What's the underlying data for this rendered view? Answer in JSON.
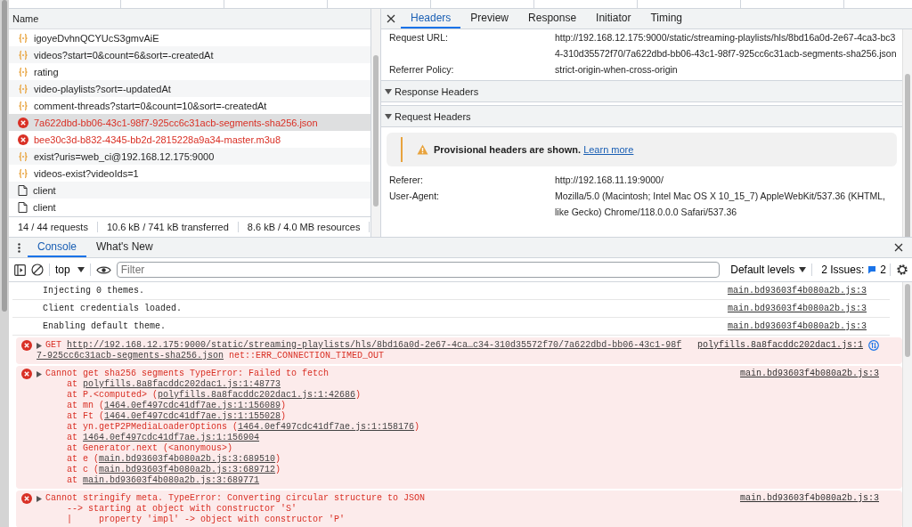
{
  "network": {
    "column_name": "Name",
    "requests": [
      {
        "name": "igoyeDvhnQCYUcS3gmvAiE",
        "kind": "fetch",
        "selected": false
      },
      {
        "name": "videos?start=0&count=6&sort=-createdAt",
        "kind": "fetch",
        "selected": false
      },
      {
        "name": "rating",
        "kind": "fetch",
        "selected": false
      },
      {
        "name": "video-playlists?sort=-updatedAt",
        "kind": "fetch",
        "selected": false
      },
      {
        "name": "comment-threads?start=0&count=10&sort=-createdAt",
        "kind": "fetch",
        "selected": false
      },
      {
        "name": "7a622dbd-bb06-43c1-98f7-925cc6c31acb-segments-sha256.json",
        "kind": "error",
        "selected": true
      },
      {
        "name": "bee30c3d-b832-4345-bb2d-2815228a9a34-master.m3u8",
        "kind": "error",
        "selected": false
      },
      {
        "name": "exist?uris=web_ci@192.168.12.175:9000",
        "kind": "fetch",
        "selected": false
      },
      {
        "name": "videos-exist?videoIds=1",
        "kind": "fetch",
        "selected": false
      },
      {
        "name": "client",
        "kind": "document",
        "selected": false
      },
      {
        "name": "client",
        "kind": "document",
        "selected": false
      }
    ],
    "status": [
      "14 / 44 requests",
      "10.6 kB / 741 kB transferred",
      "8.6 kB / 4.0 MB resources"
    ]
  },
  "details": {
    "tabs": [
      {
        "label": "Headers",
        "selected": true
      },
      {
        "label": "Preview",
        "selected": false
      },
      {
        "label": "Response",
        "selected": false
      },
      {
        "label": "Initiator",
        "selected": false
      },
      {
        "label": "Timing",
        "selected": false
      }
    ],
    "general": [
      {
        "name": "Request URL:",
        "value": "http://192.168.12.175:9000/static/streaming-playlists/hls/8bd16a0d-2e67-4ca3-bc34-310d35572f70/7a622dbd-bb06-43c1-98f7-925cc6c31acb-segments-sha256.json"
      },
      {
        "name": "Referrer Policy:",
        "value": "strict-origin-when-cross-origin"
      }
    ],
    "sections": [
      {
        "title": "Response Headers",
        "expanded": true
      },
      {
        "title": "Request Headers",
        "expanded": true
      }
    ],
    "warning": {
      "text": "Provisional headers are shown.",
      "link": "Learn more"
    },
    "request_headers": [
      {
        "name": "Referer:",
        "value": "http://192.168.11.19:9000/"
      },
      {
        "name": "User-Agent:",
        "value": "Mozilla/5.0 (Macintosh; Intel Mac OS X 10_15_7) AppleWebKit/537.36 (KHTML, like Gecko) Chrome/118.0.0.0 Safari/537.36"
      }
    ]
  },
  "drawer": {
    "tabs": [
      {
        "label": "Console",
        "selected": true
      },
      {
        "label": "What's New",
        "selected": false
      }
    ],
    "context": "top",
    "filter": {
      "placeholder": "Filter"
    },
    "levels": "Default levels",
    "issues": "2 Issues:",
    "issues_count": "2"
  },
  "console": [
    {
      "kind": "info",
      "text": "Injecting 0 themes.",
      "source": "main.bd93603f4b080a2b.js:3"
    },
    {
      "kind": "info",
      "text": "Client credentials loaded.",
      "source": "main.bd93603f4b080a2b.js:3"
    },
    {
      "kind": "info",
      "text": "Enabling default theme.",
      "source": "main.bd93603f4b080a2b.js:3"
    },
    {
      "kind": "network_error",
      "method": "GET",
      "url_lines": [
        "http://192.168.12.175:9000/static/streaming-playlists/hls/8bd16a0d-2e67-4ca…c34-310d35572f70/7a622dbd-bb06-43c1-98f",
        "7-925cc6c31acb-segments-sha256.json"
      ],
      "error": "net::ERR_CONNECTION_TIMED_OUT",
      "source": "polyfills.8a8facddc202dac1.js:1"
    },
    {
      "kind": "error",
      "text": "Cannot get sha256 segments TypeError: Failed to fetch",
      "source": "main.bd93603f4b080a2b.js:3",
      "lines": [
        {
          "prefix": "at ",
          "link": "polyfills.8a8facddc202dac1.js:1:48773"
        },
        {
          "prefix": "at P.<computed> (",
          "link": "polyfills.8a8facddc202dac1.js:1:42686",
          "suffix": ")"
        },
        {
          "prefix": "at mn (",
          "link": "1464.0ef497cdc41df7ae.js:1:156089",
          "suffix": ")"
        },
        {
          "prefix": "at Ft (",
          "link": "1464.0ef497cdc41df7ae.js:1:155028",
          "suffix": ")"
        },
        {
          "prefix": "at yn.getP2PMediaLoaderOptions (",
          "link": "1464.0ef497cdc41df7ae.js:1:158176",
          "suffix": ")"
        },
        {
          "prefix": "at ",
          "link": "1464.0ef497cdc41df7ae.js:1:156904"
        },
        {
          "prefix": "at Generator.next (<anonymous>)"
        },
        {
          "prefix": "at e (",
          "link": "main.bd93603f4b080a2b.js:3:689510",
          "suffix": ")"
        },
        {
          "prefix": "at c (",
          "link": "main.bd93603f4b080a2b.js:3:689712",
          "suffix": ")"
        },
        {
          "prefix": "at ",
          "link": "main.bd93603f4b080a2b.js:3:689771"
        }
      ]
    },
    {
      "kind": "error",
      "text": "Cannot stringify meta. TypeError: Converting circular structure to JSON",
      "source": "main.bd93603f4b080a2b.js:3",
      "lines": [
        {
          "prefix": "--> starting at object with constructor 'S'"
        },
        {
          "prefix": "|     property 'impl' -> object with constructor 'P'"
        }
      ]
    }
  ]
}
